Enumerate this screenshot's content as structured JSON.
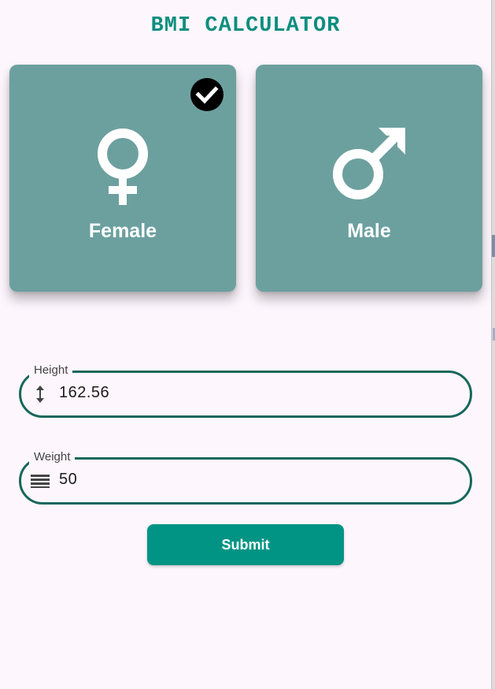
{
  "app": {
    "title": "BMI CALCULATOR"
  },
  "gender": {
    "female": {
      "label": "Female",
      "icon": "female-symbol-icon",
      "selected": true
    },
    "male": {
      "label": "Male",
      "icon": "male-symbol-icon",
      "selected": false
    }
  },
  "form": {
    "height": {
      "label": "Height",
      "value": "162.56",
      "icon": "height-arrows-icon"
    },
    "weight": {
      "label": "Weight",
      "value": "50",
      "icon": "scale-lines-icon"
    }
  },
  "actions": {
    "submit_label": "Submit"
  },
  "colors": {
    "title": "#0c8e7e",
    "card": "#6ca09f",
    "field_border": "#17675d",
    "button": "#019484",
    "background": "#fdf6fd"
  }
}
